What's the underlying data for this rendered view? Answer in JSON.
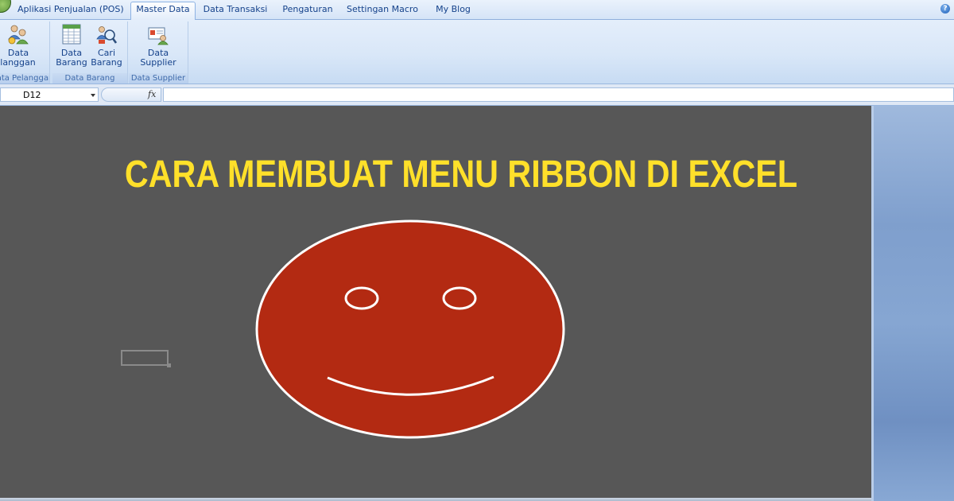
{
  "tabs": [
    {
      "label": "Aplikasi Penjualan (POS)",
      "active": false
    },
    {
      "label": "Master Data",
      "active": true
    },
    {
      "label": "Data Transaksi",
      "active": false
    },
    {
      "label": "Pengaturan",
      "active": false
    },
    {
      "label": "Settingan Macro",
      "active": false
    },
    {
      "label": "My Blog",
      "active": false
    }
  ],
  "help_icon": "question-mark-icon",
  "ribbon": {
    "groups": [
      {
        "caption": "Data Pelanggan",
        "buttons": [
          {
            "label_1": "Data",
            "label_2": "Pelanggan",
            "icon": "people-icon"
          }
        ]
      },
      {
        "caption": "Data Barang",
        "buttons": [
          {
            "label_1": "Data",
            "label_2": "Barang",
            "icon": "spreadsheet-icon"
          },
          {
            "label_1": "Cari",
            "label_2": "Barang",
            "icon": "search-people-icon"
          }
        ]
      },
      {
        "caption": "Data Supplier",
        "buttons": [
          {
            "label_1": "Data",
            "label_2": "Supplier",
            "icon": "contact-card-icon"
          }
        ]
      }
    ]
  },
  "formula_bar": {
    "name_box": "D12",
    "fx": "fx",
    "formula": ""
  },
  "sheet": {
    "title": "CARA MEMBUAT MENU RIBBON DI EXCEL",
    "title_color": "#ffe02a",
    "background_color": "#575757",
    "smiley": {
      "face_color": "#b32a12",
      "outline_color": "#ffffff"
    }
  }
}
